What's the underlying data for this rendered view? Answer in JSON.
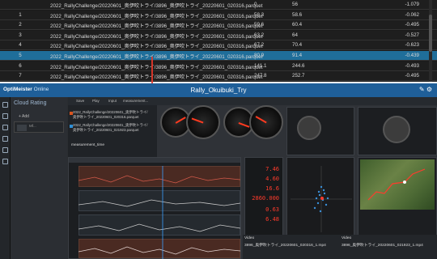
{
  "table": {
    "rows": [
      {
        "index": "",
        "path": "2022_RallyChallenge/20220601_奥伊吹トライ/3896_奥伊吹トライ_20220601_020316.parquet",
        "v1": "0",
        "v2": "56",
        "v3": "-1.079"
      },
      {
        "index": "1",
        "path": "2022_RallyChallenge/20220601_奥伊吹トライ/3896_奥伊吹トライ_20220601_020316.parquet",
        "v1": "58.3",
        "v2": "58.6",
        "v3": "-0.062"
      },
      {
        "index": "2",
        "path": "2022_RallyChallenge/20220601_奥伊吹トライ/3896_奥伊吹トライ_20220601_020316.parquet",
        "v1": "59.6",
        "v2": "60.4",
        "v3": "-0.495"
      },
      {
        "index": "3",
        "path": "2022_RallyChallenge/20220601_奥伊吹トライ/3896_奥伊吹トライ_20220601_020316.parquet",
        "v1": "63.2",
        "v2": "64",
        "v3": "-0.527"
      },
      {
        "index": "4",
        "path": "2022_RallyChallenge/20220601_奥伊吹トライ/3896_奥伊吹トライ_20220601_020316.parquet",
        "v1": "67.2",
        "v2": "70.4",
        "v3": "-0.623"
      },
      {
        "index": "5",
        "path": "2022_RallyChallenge/20220601_奥伊吹トライ/3896_奥伊吹トライ_20220601_020316.parquet",
        "v1": "80.9",
        "v2": "91.4",
        "v3": "-0.439",
        "selected": true
      },
      {
        "index": "6",
        "path": "2022_RallyChallenge/20220601_奥伊吹トライ/3896_奥伊吹トライ_20220601_020316.parquet",
        "v1": "141.1",
        "v2": "244.6",
        "v3": "-0.493"
      },
      {
        "index": "7",
        "path": "2022_RallyChallenge/20220601_奥伊吹トライ/3896_奥伊吹トライ_20220601_020316.parquet",
        "v1": "247.8",
        "v2": "252.7",
        "v3": "-0.495"
      }
    ]
  },
  "app": {
    "logo": "OptiMeister",
    "logo_sub": "Online",
    "title": "Rally_Okuibuki_Try",
    "sidebar_title": "Cloud Rating",
    "sidebar_add": "+ Add",
    "sidebar_item": "Mf...",
    "toolbar": [
      "Save",
      "Play",
      "Input",
      "measurement..."
    ],
    "files": [
      "2022_RallyChallenge/20220601_奥伊吹トライ/",
      "奥伊吹トライ_20220601_020316.parquet",
      "2022_RallyChallenge/20220601_奥伊吹トライ/",
      "奥伊吹トライ_20220601_021923.parquet"
    ],
    "files_label": "measurement_time",
    "meters": [
      {
        "label": "",
        "value": "7.46"
      },
      {
        "label": "",
        "value": "4.60"
      },
      {
        "label": "",
        "value": "16.6"
      },
      {
        "label": "",
        "value": "2860.000"
      },
      {
        "label": "",
        "value": "0.63"
      },
      {
        "label": "",
        "value": "6.48"
      }
    ],
    "video_labels": [
      "Video",
      "3896_奥伊吹トライ_20220601_020316_1.mp4",
      "Video",
      "3896_奥伊吹トライ_20220601_021923_1.mp4"
    ],
    "colors": {
      "accent": "#1f5f99",
      "selected_row": "#1f6e9a",
      "arrow": "#e8372a",
      "meter": "#ff3b2c"
    }
  }
}
